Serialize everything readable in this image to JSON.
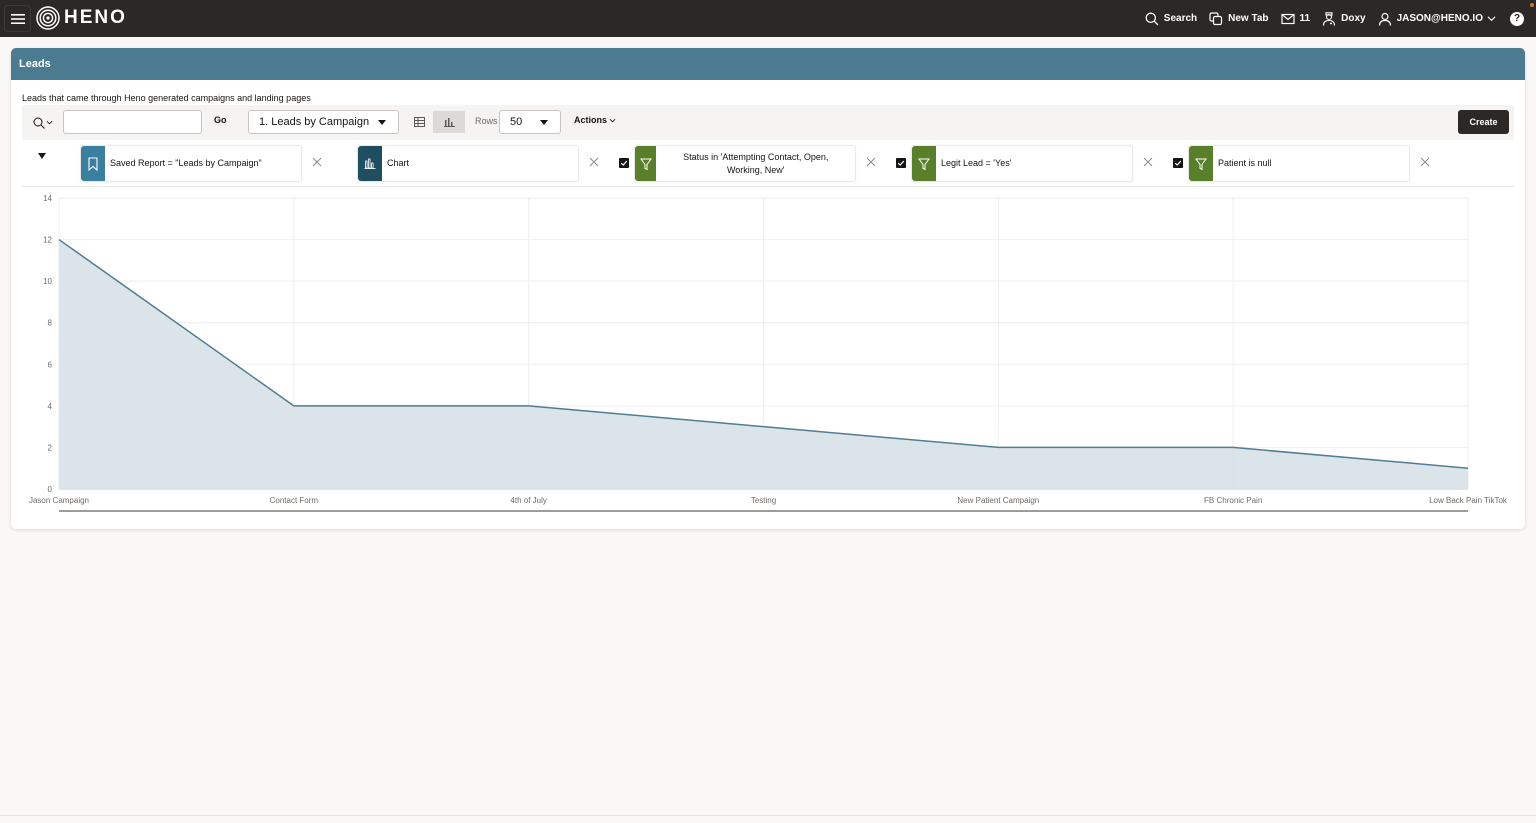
{
  "header": {
    "menu_icon": "hamburger-icon",
    "logo_text": "HENO",
    "search_label": "Search",
    "new_tab_label": "New Tab",
    "mail_count": "11",
    "doxy_label": "Doxy",
    "user_label": "JASON@HENO.IO",
    "help_label": "?"
  },
  "region": {
    "title": "Leads",
    "description": "Leads that came through Heno generated campaigns and landing pages"
  },
  "toolbar": {
    "search_value": "",
    "go_label": "Go",
    "report_selected": "1. Leads by Campaign",
    "rows_label": "Rows",
    "rows_selected": "50",
    "actions_label": "Actions",
    "create_label": "Create"
  },
  "filters": [
    {
      "type": "saved-report",
      "label": "Saved Report = \"Leads by Campaign\"",
      "color": "#3a7fa0",
      "checked": null
    },
    {
      "type": "chart",
      "label": "Chart",
      "color": "#1f4e61",
      "checked": null
    },
    {
      "type": "filter",
      "label": "Status in 'Attempting Contact, Open, Working, New'",
      "color": "#5a7f2b",
      "checked": true
    },
    {
      "type": "filter",
      "label": "Legit Lead = 'Yes'",
      "color": "#5a7f2b",
      "checked": true
    },
    {
      "type": "filter",
      "label": "Patient is null",
      "color": "#5a7f2b",
      "checked": true
    }
  ],
  "colors": {
    "topbar": "#2b2826",
    "region_header": "#4a7b91",
    "series_line": "#4f7d93",
    "series_fill": "#d7e2e7"
  },
  "chart_data": {
    "type": "area",
    "title": "",
    "xlabel": "",
    "ylabel": "",
    "categories": [
      "Jason Campaign",
      "Contact Form",
      "4th of July",
      "Testing",
      "New Patient Campaign",
      "FB Chronic Pain",
      "Low Back Pain TikTok"
    ],
    "values": [
      12,
      4,
      4,
      3,
      2,
      2,
      1
    ],
    "ylim": [
      0,
      14
    ],
    "yticks": [
      0,
      2,
      4,
      6,
      8,
      10,
      12,
      14
    ],
    "grid": true,
    "legend": "none"
  }
}
